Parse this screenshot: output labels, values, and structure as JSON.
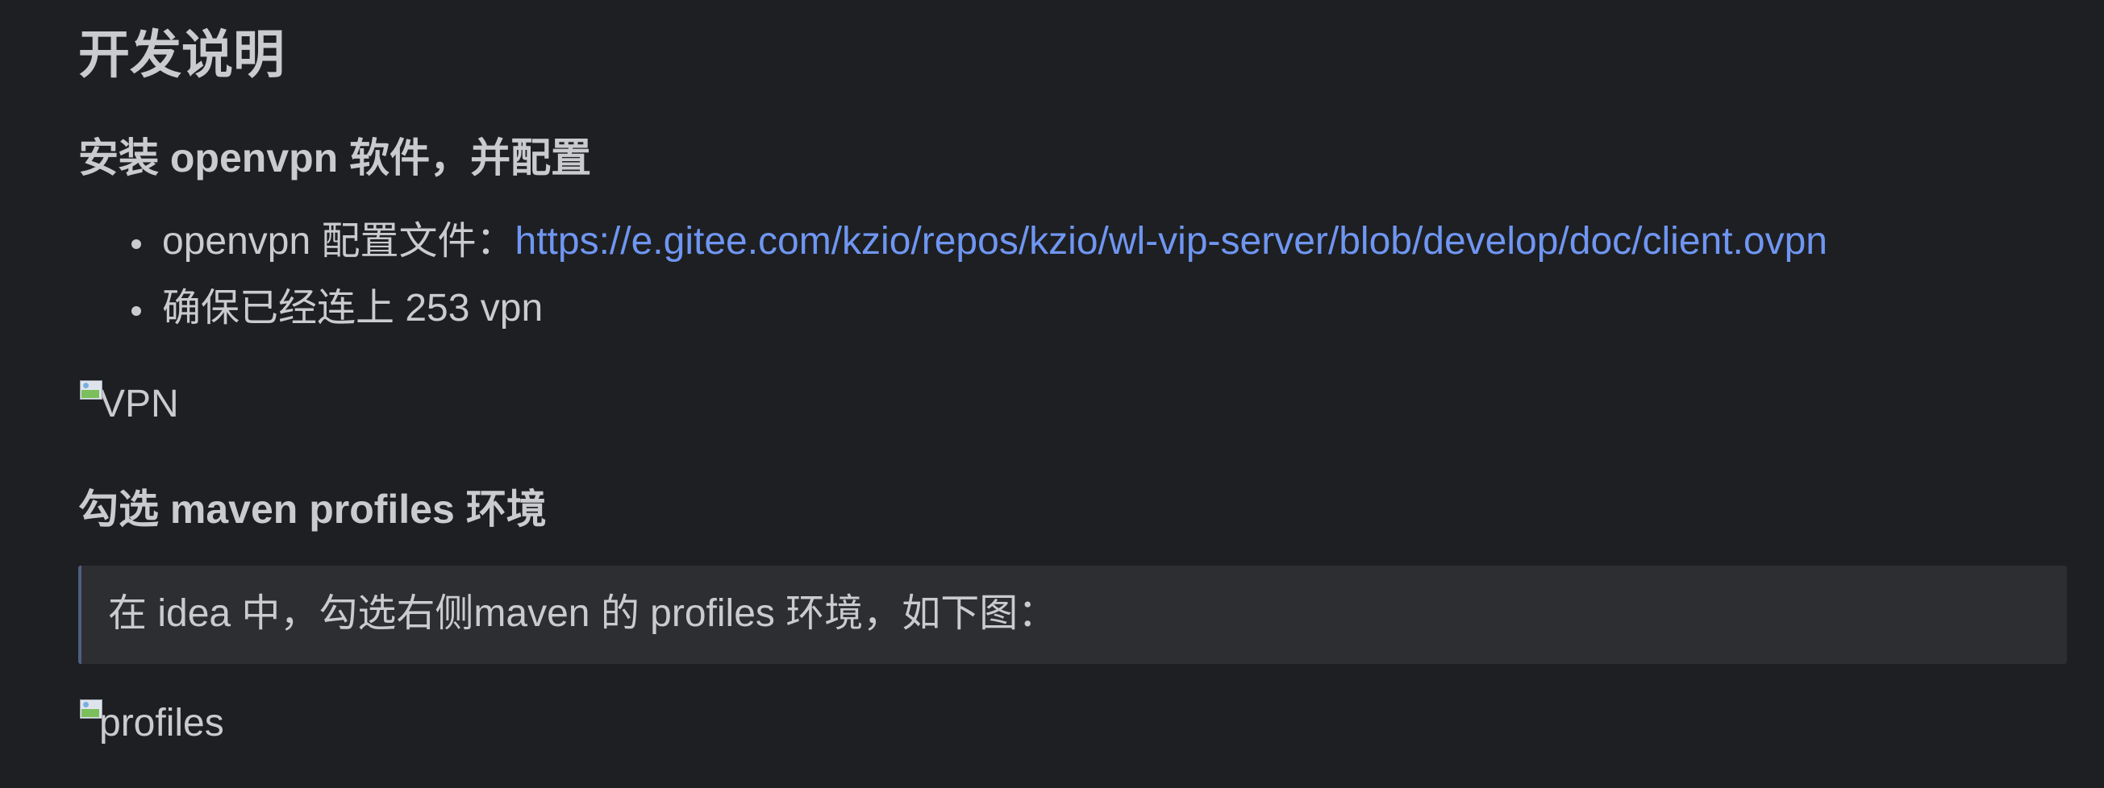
{
  "page": {
    "title": "开发说明"
  },
  "section_vpn": {
    "heading": "安装 openvpn 软件，并配置",
    "bullets": [
      {
        "prefix": "openvpn 配置文件：",
        "link_text": "https://e.gitee.com/kzio/repos/kzio/wl-vip-server/blob/develop/doc/client.ovpn"
      },
      {
        "text": "确保已经连上 253 vpn"
      }
    ],
    "image_alt": "VPN"
  },
  "section_maven": {
    "heading": "勾选 maven profiles 环境",
    "quote": "在 idea 中，勾选右侧maven 的 profiles 环境，如下图：",
    "image_alt": "profiles"
  },
  "colors": {
    "background": "#1e1f22",
    "text": "#c9cbcf",
    "link": "#6f96f2",
    "blockquote_bg": "#2d2e32",
    "blockquote_border": "#4d5f80"
  },
  "icons": {
    "broken_image": "broken-image-icon"
  }
}
